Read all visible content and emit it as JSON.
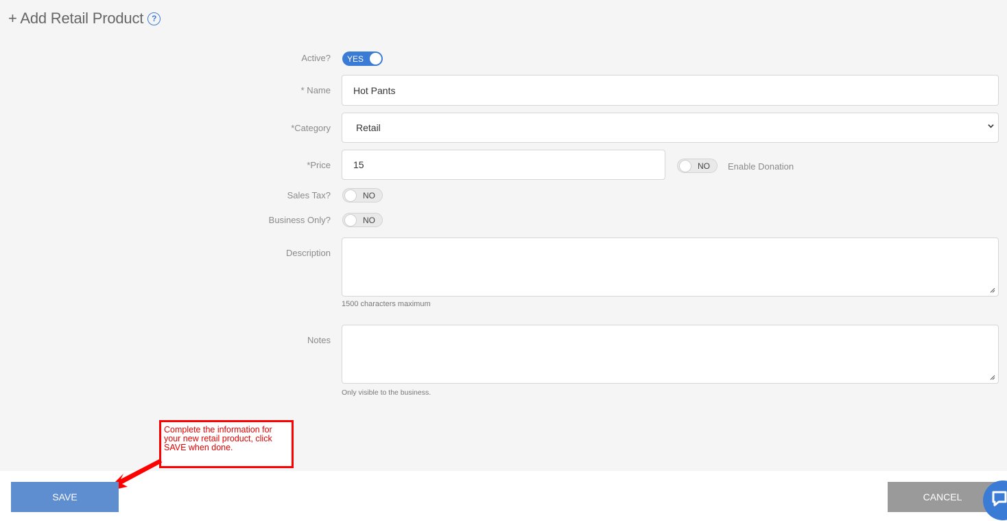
{
  "header": {
    "title": "+ Add Retail Product",
    "help_icon": "question-circle-icon"
  },
  "form": {
    "active": {
      "label": "Active?",
      "value": "YES"
    },
    "name": {
      "label": "* Name",
      "value": "Hot Pants"
    },
    "category": {
      "label": "*Category",
      "value": "Retail"
    },
    "price": {
      "label": "*Price",
      "value": "15"
    },
    "donation": {
      "value": "NO",
      "label": "Enable Donation"
    },
    "sales_tax": {
      "label": "Sales Tax?",
      "value": "NO"
    },
    "business_only": {
      "label": "Business Only?",
      "value": "NO"
    },
    "description": {
      "label": "Description",
      "value": "",
      "hint": "1500 characters maximum"
    },
    "notes": {
      "label": "Notes",
      "value": "",
      "hint": "Only visible to the business."
    }
  },
  "annotation": {
    "text": "Complete the information for your new retail product, click SAVE when done."
  },
  "footer": {
    "save_label": "SAVE",
    "cancel_label": "CANCEL"
  },
  "colors": {
    "accent": "#3a7bd5",
    "save": "#5f8ed0",
    "cancel": "#9a9a9a",
    "callout": "#ff0000"
  }
}
